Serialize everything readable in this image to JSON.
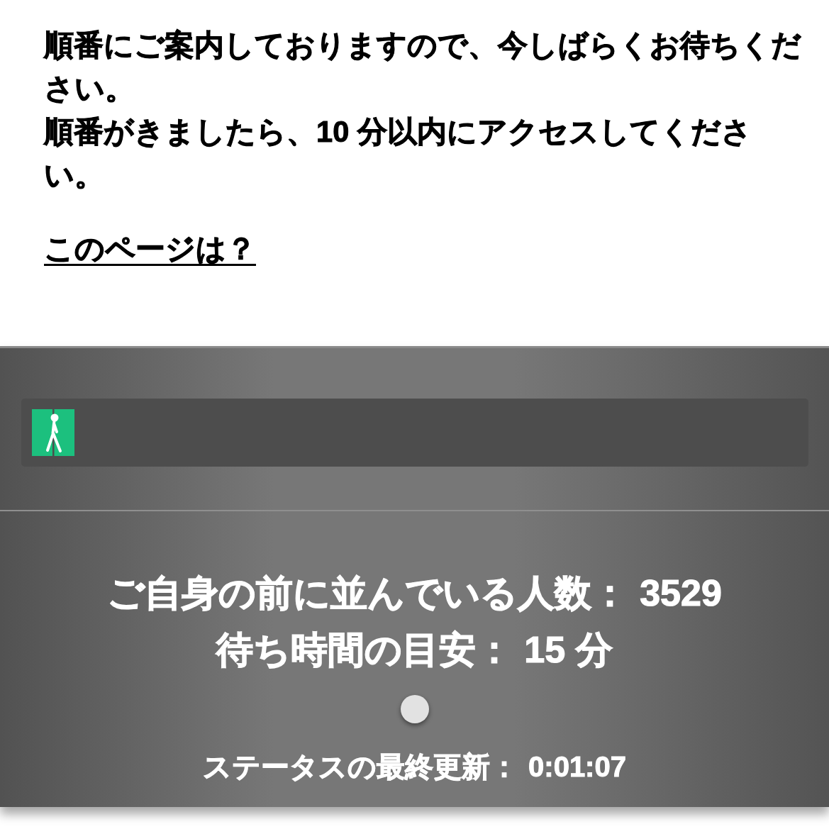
{
  "notice": {
    "paragraphs": [
      "順番にご案内しておりますので、今しばらくお待ちください。",
      "順番がきましたら、10 分以内にアクセスしてください。"
    ],
    "link": "このページは？"
  },
  "queue_panel": {
    "progress": {
      "level": 0
    },
    "stats": [
      {
        "label": "ご自身の前に並んでいる人数：",
        "value": "3529"
      },
      {
        "label": "待ち時間の目安：",
        "value": "15 分"
      }
    ],
    "last_updated": {
      "label": "ステータスの最終更新：",
      "value": "0:01:07"
    }
  }
}
